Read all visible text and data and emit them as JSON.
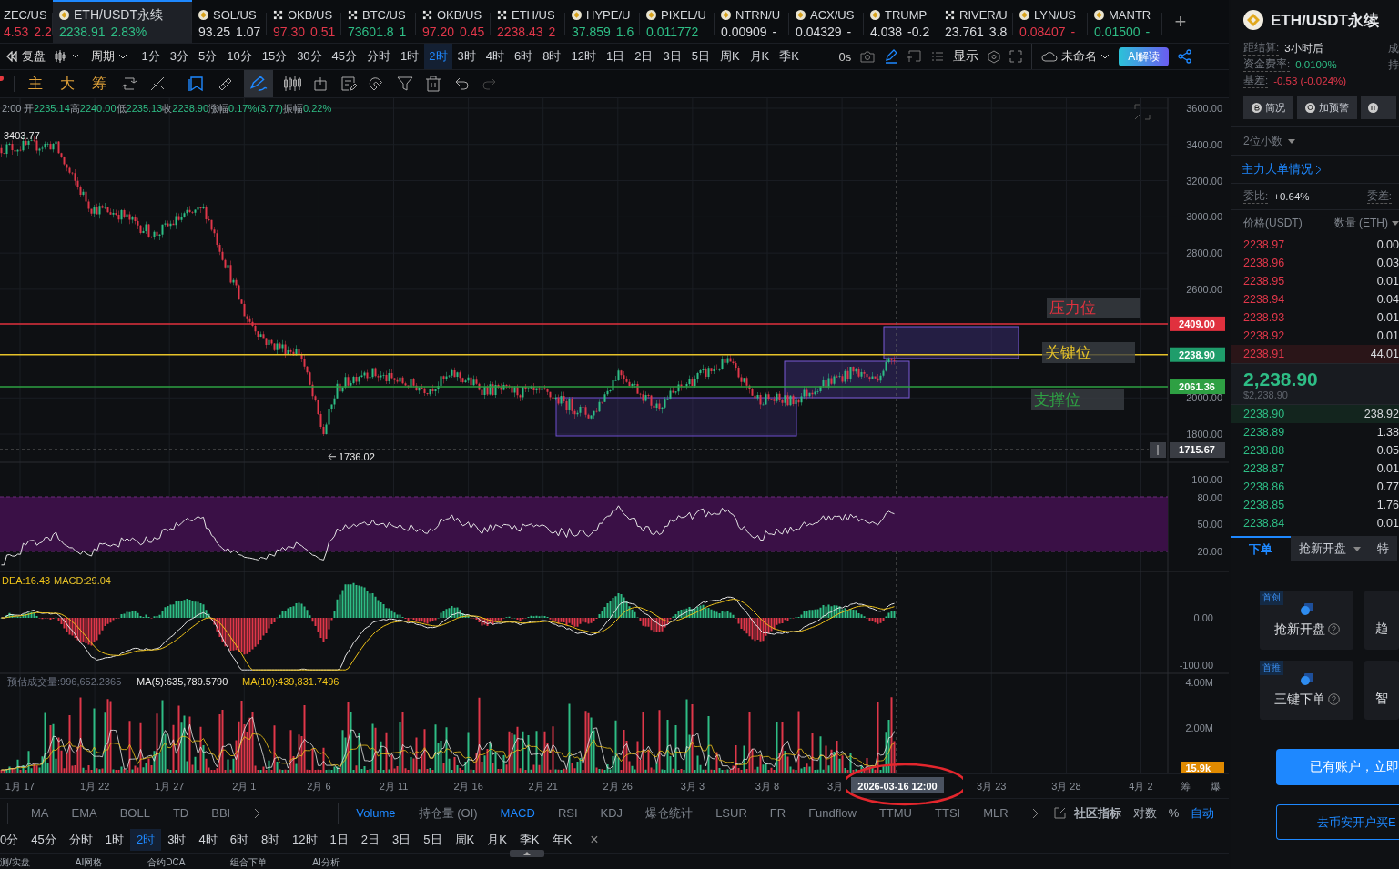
{
  "tabs": [
    {
      "kind": "plain",
      "symbol": "ZEC/US",
      "price": "4.53",
      "change": "2.2",
      "color": "#e0374a",
      "selected": false
    },
    {
      "kind": "coin",
      "symbol": "ETH/USDT永续",
      "price": "2238.91",
      "change": "2.83%",
      "color": "#2ebd85",
      "selected": true
    },
    {
      "kind": "coin",
      "symbol": "SOL/US",
      "price": "93.25",
      "change": "1.07",
      "color": "#d8dade",
      "selected": false
    },
    {
      "kind": "cross",
      "symbol": "OKB/US",
      "price": "97.30",
      "change": "0.51",
      "color": "#e0374a",
      "selected": false
    },
    {
      "kind": "cross",
      "symbol": "BTC/US",
      "price": "73601.8",
      "change": "1",
      "color": "#2ebd85",
      "selected": false
    },
    {
      "kind": "cross",
      "symbol": "OKB/US",
      "price": "97.20",
      "change": "0.45",
      "color": "#e0374a",
      "selected": false
    },
    {
      "kind": "cross",
      "symbol": "ETH/US",
      "price": "2238.43",
      "change": "2",
      "color": "#e0374a",
      "selected": false
    },
    {
      "kind": "coin",
      "symbol": "HYPE/U",
      "price": "37.859",
      "change": "1.6",
      "color": "#2ebd85",
      "selected": false
    },
    {
      "kind": "coin",
      "symbol": "PIXEL/U",
      "price": "0.011772",
      "color": "#2ebd85",
      "selected": false
    },
    {
      "kind": "coin",
      "symbol": "NTRN/U",
      "price": "0.00909",
      "change": "-",
      "color": "#d8dade",
      "selected": false
    },
    {
      "kind": "coin",
      "symbol": "ACX/US",
      "price": "0.04329",
      "change": "-",
      "color": "#d8dade",
      "selected": false
    },
    {
      "kind": "coin",
      "symbol": "TRUMP",
      "price": "4.038",
      "change": "-0.2",
      "color": "#d8dade",
      "selected": false
    },
    {
      "kind": "cross",
      "symbol": "RIVER/U",
      "price": "23.761",
      "change": "3.8",
      "color": "#d8dade",
      "selected": false
    },
    {
      "kind": "coin",
      "symbol": "LYN/US",
      "price": "0.08407",
      "change": "-",
      "color": "#e0374a",
      "selected": false
    },
    {
      "kind": "coin",
      "symbol": "MANTR",
      "price": "0.01500",
      "change": "-",
      "color": "#2ebd85",
      "selected": false
    }
  ],
  "add_tab": "+",
  "toolbar": {
    "replay": "复盘",
    "period_menu": "周期",
    "periods": [
      {
        "label": "1分",
        "selected": false
      },
      {
        "label": "3分",
        "selected": false
      },
      {
        "label": "5分",
        "selected": false
      },
      {
        "label": "10分",
        "selected": false
      },
      {
        "label": "15分",
        "selected": false
      },
      {
        "label": "30分",
        "selected": false
      },
      {
        "label": "45分",
        "selected": false
      },
      {
        "label": "分时",
        "selected": false
      },
      {
        "label": "1时",
        "selected": false
      },
      {
        "label": "2时",
        "selected": true
      },
      {
        "label": "3时",
        "selected": false
      },
      {
        "label": "4时",
        "selected": false
      },
      {
        "label": "6时",
        "selected": false
      },
      {
        "label": "8时",
        "selected": false
      },
      {
        "label": "12时",
        "selected": false
      },
      {
        "label": "1日",
        "selected": false
      },
      {
        "label": "2日",
        "selected": false
      },
      {
        "label": "3日",
        "selected": false
      },
      {
        "label": "5日",
        "selected": false
      },
      {
        "label": "周K",
        "selected": false
      },
      {
        "label": "月K",
        "selected": false
      },
      {
        "label": "季K",
        "selected": false
      }
    ],
    "countdown": "0s",
    "display": "显示",
    "layout_name": "未命名",
    "ai_button": "AI解读"
  },
  "drawing_toolbar": {
    "chips": [
      "主",
      "大",
      "筹"
    ]
  },
  "chart": {
    "info_time": "2:00",
    "ohlc": [
      {
        "label": "开",
        "value": "2235.14"
      },
      {
        "label": "高",
        "value": "2240.00"
      },
      {
        "label": "低",
        "value": "2235.13"
      },
      {
        "label": "收",
        "value": "2238.90"
      },
      {
        "label": "涨幅",
        "value": "0.17%(3.77)"
      },
      {
        "label": "振幅",
        "value": "0.22%"
      }
    ],
    "price_ticks": [
      "3600.00",
      "3400.00",
      "3200.00",
      "3000.00",
      "2800.00",
      "2600.00",
      "2000.00",
      "1800.00"
    ],
    "levels": [
      {
        "kind": "resistance",
        "label": "压力位",
        "price": "2409.00",
        "color": "#e0313e"
      },
      {
        "kind": "key",
        "label": "关键位",
        "price": "2238.90",
        "color": "#e6c229"
      },
      {
        "kind": "support",
        "label": "支撑位",
        "price": "2061.36",
        "color": "#2ea043"
      }
    ],
    "high_label": "3403.77",
    "low_label": "1736.02",
    "crosshair": {
      "price": "1715.67",
      "time": "2026-03-16 12:00"
    },
    "rsi_ticks": [
      "100.00",
      "80.00",
      "50.00",
      "20.00"
    ],
    "macd_legend": [
      {
        "text": "DEA:16.43",
        "color": "#f0c419"
      },
      {
        "text": "MACD:29.04",
        "color": "#e6c229"
      }
    ],
    "macd_ticks": [
      "0.00",
      "-100.00"
    ],
    "volume_legend": [
      {
        "text": "预估成交量:996,652.2365",
        "color": "#6b7280"
      },
      {
        "text": "MA(5):635,789.5790",
        "color": "#e8e8e8"
      },
      {
        "text": "MA(10):439,831.7496",
        "color": "#f0c419"
      }
    ],
    "volume_ticks": [
      "4.00M",
      "2.00M"
    ],
    "volume_current": "15.9k",
    "dates": [
      "1月 17",
      "1月 22",
      "1月 27",
      "2月 1",
      "2月 6",
      "2月 11",
      "2月 16",
      "2月 21",
      "2月 26",
      "3月 3",
      "3月 8",
      "3月",
      "3月 23",
      "3月 28",
      "4月 2"
    ],
    "axis_side": [
      "筹",
      "爆"
    ]
  },
  "indicators": {
    "main": [
      "MA",
      "EMA",
      "BOLL",
      "TD",
      "BBI"
    ],
    "sub": [
      {
        "label": "Volume",
        "selected": true
      },
      {
        "label": "持仓量 (OI)",
        "selected": false
      },
      {
        "label": "MACD",
        "selected": true
      },
      {
        "label": "RSI",
        "selected": false
      },
      {
        "label": "KDJ",
        "selected": false
      },
      {
        "label": "爆仓统计",
        "selected": false
      },
      {
        "label": "LSUR",
        "selected": false
      },
      {
        "label": "FR",
        "selected": false
      },
      {
        "label": "Fundflow",
        "selected": false
      },
      {
        "label": "TTMU",
        "selected": false
      },
      {
        "label": "TTSI",
        "selected": false
      },
      {
        "label": "MLR",
        "selected": false
      }
    ],
    "community": "社区指标",
    "options": [
      {
        "label": "对数",
        "selected": false
      },
      {
        "label": "%",
        "selected": false
      },
      {
        "label": "自动",
        "selected": true
      }
    ]
  },
  "period_bar": [
    {
      "label": "0分",
      "selected": false
    },
    {
      "label": "45分",
      "selected": false
    },
    {
      "label": "分时",
      "selected": false
    },
    {
      "label": "1时",
      "selected": false
    },
    {
      "label": "2时",
      "selected": true
    },
    {
      "label": "3时",
      "selected": false
    },
    {
      "label": "4时",
      "selected": false
    },
    {
      "label": "6时",
      "selected": false
    },
    {
      "label": "8时",
      "selected": false
    },
    {
      "label": "12时",
      "selected": false
    },
    {
      "label": "1日",
      "selected": false
    },
    {
      "label": "2日",
      "selected": false
    },
    {
      "label": "3日",
      "selected": false
    },
    {
      "label": "5日",
      "selected": false
    },
    {
      "label": "周K",
      "selected": false
    },
    {
      "label": "月K",
      "selected": false
    },
    {
      "label": "季K",
      "selected": false
    },
    {
      "label": "年K",
      "selected": false
    }
  ],
  "period_close": "×",
  "bottom_tabs": [
    "测/实盘",
    "AI网格",
    "合约DCA",
    "组合下单",
    "AI分析"
  ],
  "side": {
    "title": "ETH/USDT永续",
    "info": [
      {
        "label": "距结算:",
        "value": "3小时后",
        "color": "#d8dade",
        "right": "成"
      },
      {
        "label": "资金费率:",
        "value": "0.0100%",
        "color": "#2ebd85",
        "right": "持"
      },
      {
        "label": "基差:",
        "value": "-0.53 (-0.024%)",
        "color": "#e0374a"
      }
    ],
    "buttons": [
      "简况",
      "加预警"
    ],
    "decimals": "2位小数",
    "big_orders": "主力大单情况",
    "ratio_label": "委比:",
    "ratio_value": "+0.64%",
    "diff_label": "委差:",
    "col_price": "价格(USDT)",
    "col_qty": "数量 (ETH)",
    "asks": [
      {
        "price": "2238.97",
        "qty": "0.00"
      },
      {
        "price": "2238.96",
        "qty": "0.03"
      },
      {
        "price": "2238.95",
        "qty": "0.01"
      },
      {
        "price": "2238.94",
        "qty": "0.04"
      },
      {
        "price": "2238.93",
        "qty": "0.01"
      },
      {
        "price": "2238.92",
        "qty": "0.01"
      },
      {
        "price": "2238.91",
        "qty": "44.01"
      }
    ],
    "last_price": "2,238.90",
    "last_usd": "$2,238.90",
    "bids": [
      {
        "price": "2238.90",
        "qty": "238.92"
      },
      {
        "price": "2238.89",
        "qty": "1.38"
      },
      {
        "price": "2238.88",
        "qty": "0.05"
      },
      {
        "price": "2238.87",
        "qty": "0.01"
      },
      {
        "price": "2238.86",
        "qty": "0.77"
      },
      {
        "price": "2238.85",
        "qty": "1.76"
      },
      {
        "price": "2238.84",
        "qty": "0.01"
      }
    ],
    "order_tabs": [
      {
        "label": "下单",
        "selected": true
      },
      {
        "label": "抢新开盘",
        "selected": false
      },
      {
        "label": "特",
        "selected": false
      }
    ],
    "cards": [
      {
        "badge": "首创",
        "label": "抢新开盘",
        "peek": "趋"
      },
      {
        "badge": "首推",
        "label": "三键下单",
        "peek": "智"
      }
    ],
    "login_button": "已有账户，立即",
    "open_button": "去币安开户买E"
  }
}
